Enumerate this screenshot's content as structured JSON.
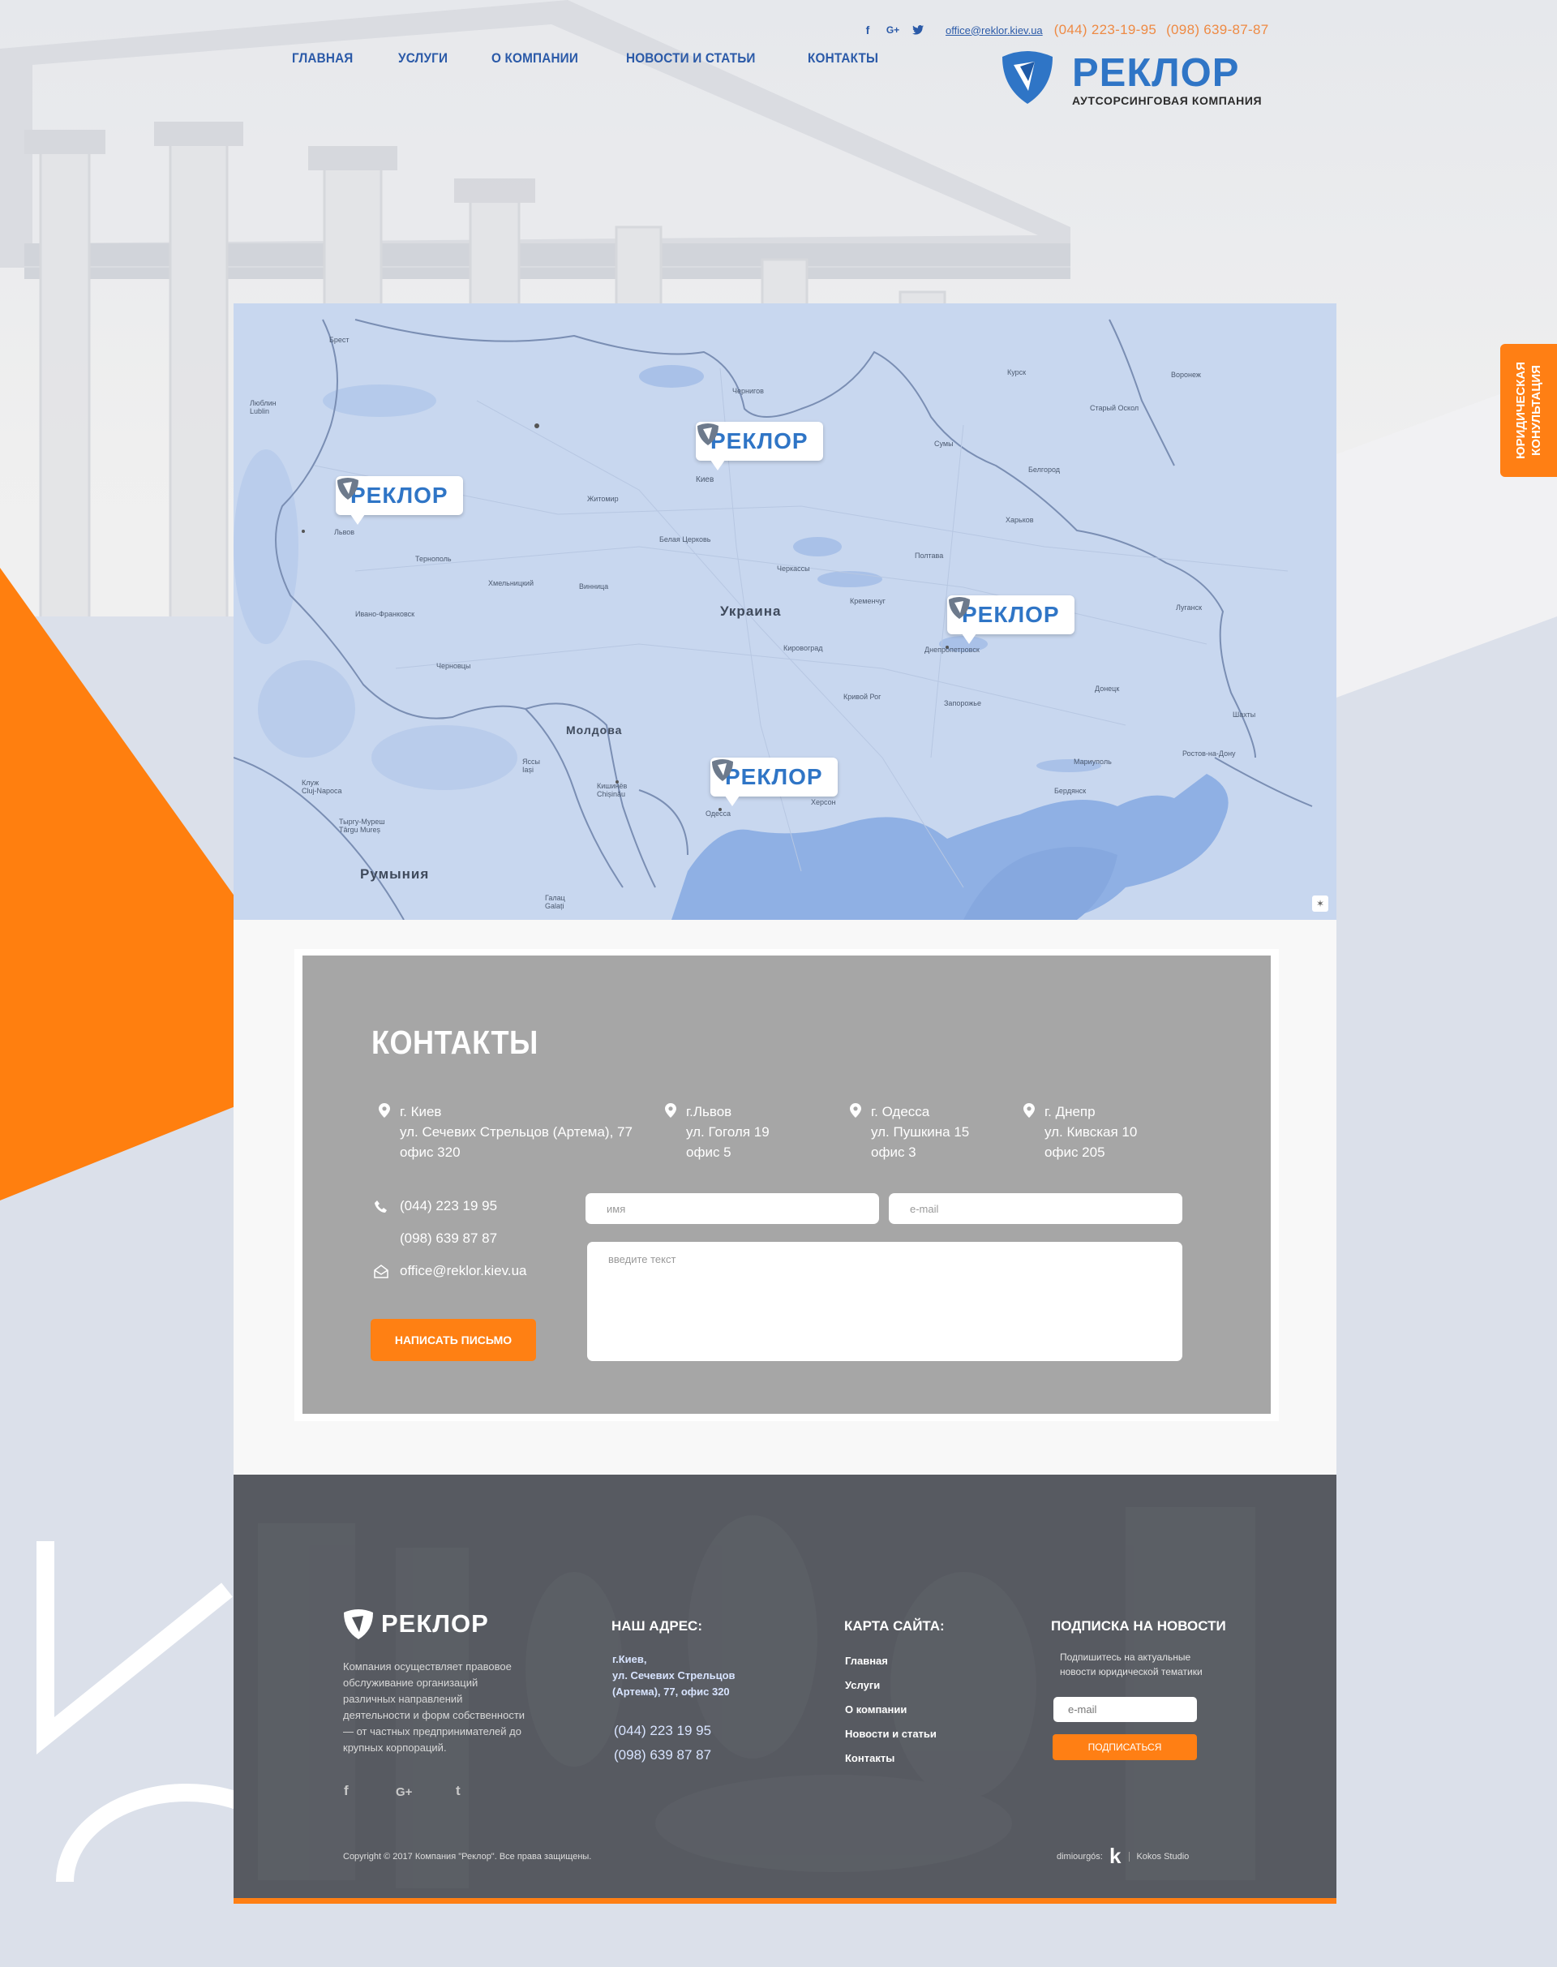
{
  "header": {
    "nav": [
      "ГЛАВНАЯ",
      "УСЛУГИ",
      "О КОМПАНИИ",
      "НОВОСТИ И СТАТЬИ",
      "КОНТАКТЫ"
    ],
    "social_icons": [
      "facebook-icon",
      "google-plus-icon",
      "twitter-icon"
    ],
    "email": "office@reklor.kiev.ua",
    "phone1": "(044) 223-19-95",
    "phone2": "(098) 639-87-87",
    "logo_word": "РЕКЛОР",
    "logo_subtitle": "АУТСОРСИНГОВАЯ КОМПАНИЯ"
  },
  "side_tab": {
    "label": "ЮРИДИЧЕСКАЯ\nКОНУЛЬТАЦИЯ"
  },
  "map": {
    "countries": [
      "Украина",
      "Молдова",
      "Румыния"
    ],
    "cities": [
      "Люблин\nLublin",
      "Брест",
      "Чернигов",
      "Курск",
      "Воронеж",
      "Старый Оскол",
      "Сумы",
      "Белгород",
      "Киев",
      "Житомир",
      "Львов",
      "Тернополь",
      "Хмельницкий",
      "Белая Церковь",
      "Полтава",
      "Харьков",
      "Черкассы",
      "Винница",
      "Ивано-Франковск",
      "Кременчуг",
      "Луганск",
      "Днепропетровск",
      "Кировоград",
      "Черновцы",
      "Кривой Рог",
      "Донецк",
      "Запорожье",
      "Шахты",
      "Ростов-на-Дону",
      "Мариуполь",
      "Бердянск",
      "Клуж\nCluj-Napoca",
      "Яссы\nIași",
      "Кишинёв\nChișinău",
      "Херсон",
      "Одесса",
      "Тыргу-Муреш\nTârgu Mureș",
      "Галац\nGalați"
    ],
    "pin_label": "РЕКЛОР",
    "pins_count": 4
  },
  "contacts": {
    "title": "КОНТАКТЫ",
    "addresses": [
      {
        "city": "г. Киев",
        "street": "ул. Сечевих Стрельцов (Артема), 77",
        "office": "офис 320"
      },
      {
        "city": "г.Львов",
        "street": "ул. Гоголя 19",
        "office": "офис 5"
      },
      {
        "city": "г. Одесса",
        "street": "ул. Пушкина 15",
        "office": "офис 3"
      },
      {
        "city": "г. Днепр",
        "street": "ул. Кивская 10",
        "office": "офис 205"
      }
    ],
    "phone1": "(044) 223 19 95",
    "phone2": "(098) 639 87 87",
    "email": "office@reklor.kiev.ua",
    "send_button": "НАПИСАТЬ ПИСЬМО",
    "form": {
      "name_placeholder": "имя",
      "email_placeholder": "e-mail",
      "text_placeholder": "введите текст"
    }
  },
  "footer": {
    "logo_word": "РЕКЛОР",
    "about": "Компания осуществляет правовое обслуживание организаций различных направлений деятельности и форм собственности — от частных предпринимателей до крупных корпораций.",
    "address_title": "НАШ АДРЕС:",
    "address_lines": [
      "г.Киев,",
      "ул. Сечевих Стрельцов",
      "(Артема), 77, офис 320"
    ],
    "phone1": "(044) 223 19 95",
    "phone2": "(098) 639 87 87",
    "sitemap_title": "КАРТА САЙТА:",
    "sitemap": [
      "Главная",
      "Услуги",
      "О компании",
      "Новости и статьи",
      "Контакты"
    ],
    "subscribe_title": "ПОДПИСКА НА НОВОСТИ",
    "subscribe_text": "Подпишитесь на актуальные новости юридической тематики",
    "subscribe_placeholder": "e-mail",
    "subscribe_button": "ПОДПИСАТЬСЯ",
    "social": [
      "f",
      "G+",
      "t"
    ],
    "copyright": "Copyright © 2017 Компания \"Реклор\". Все права защищены.",
    "developer_label": "dimiourgós:",
    "studio": "Kokos Studio"
  },
  "colors": {
    "accent_orange": "#ff7f14",
    "brand_blue": "#2f75c6",
    "contacts_bg": "#a6a6a6",
    "footer_bg": "#4f5258",
    "map_bg": "#c7d6ee"
  }
}
